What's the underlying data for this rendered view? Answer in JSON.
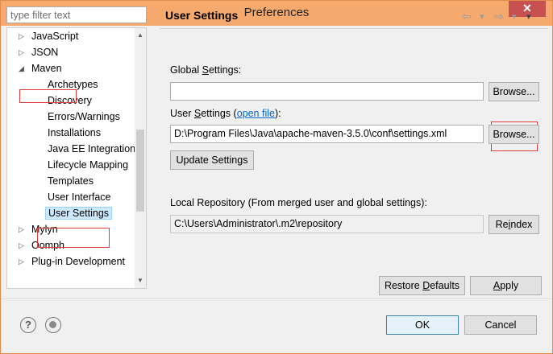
{
  "window": {
    "title": "Preferences",
    "close_glyph": "✕"
  },
  "filter": {
    "placeholder": "type filter text"
  },
  "tree": {
    "items": [
      {
        "label": "JavaScript",
        "arrow": "▷"
      },
      {
        "label": "JSON",
        "arrow": "▷"
      },
      {
        "label": "Maven",
        "arrow": "◢"
      },
      {
        "label": "Archetypes"
      },
      {
        "label": "Discovery"
      },
      {
        "label": "Errors/Warnings"
      },
      {
        "label": "Installations"
      },
      {
        "label": "Java EE Integration"
      },
      {
        "label": "Lifecycle Mapping"
      },
      {
        "label": "Templates"
      },
      {
        "label": "User Interface"
      },
      {
        "label": "User Settings",
        "selected": true
      },
      {
        "label": "Mylyn",
        "arrow": "▷"
      },
      {
        "label": "Oomph",
        "arrow": "▷"
      },
      {
        "label": "Plug-in Development",
        "arrow": "▷"
      }
    ]
  },
  "page": {
    "title": "User Settings",
    "nav_back": "⇦",
    "nav_back_menu": "▾",
    "nav_forward": "⇨",
    "nav_forward_menu": "▾",
    "menu": "▾",
    "global_label_pre": "Global ",
    "global_label_u": "S",
    "global_label_post": "ettings:",
    "global_value": "",
    "browse1": "Browse...",
    "user_label_pre": "User ",
    "user_label_u": "S",
    "user_label_mid": "ettings (",
    "user_label_link": "open file",
    "user_label_post": "):",
    "user_value": "D:\\Program Files\\Java\\apache-maven-3.5.0\\conf\\settings.xml",
    "browse2": "Browse...",
    "update_btn": "Update Settings",
    "local_label": "Local Repository (From merged user and global settings):",
    "local_value": "C:\\Users\\Administrator\\.m2\\repository",
    "reindex_pre": "Re",
    "reindex_u": "i",
    "reindex_post": "ndex",
    "restore_pre": "Restore ",
    "restore_u": "D",
    "restore_post": "efaults",
    "apply_u": "A",
    "apply_post": "pply"
  },
  "footer": {
    "help_glyph": "?",
    "ok": "OK",
    "cancel": "Cancel"
  },
  "scroll": {
    "up": "▲",
    "down": "▼"
  },
  "colors": {
    "accent": "#f6a96c",
    "highlight": "#e23a3a",
    "link": "#0066cc"
  }
}
